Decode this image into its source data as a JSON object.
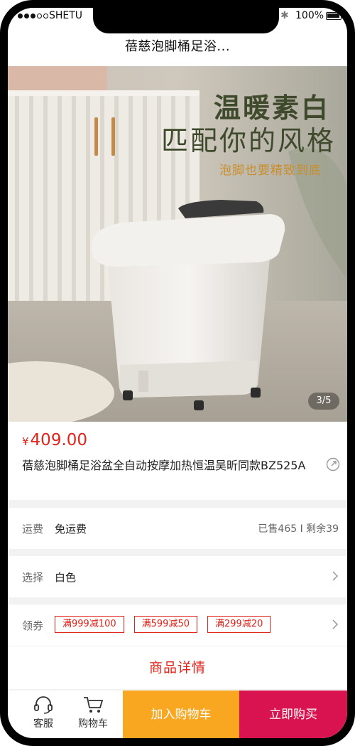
{
  "status": {
    "carrier": "SHETU",
    "battery": "100%",
    "bluetooth_glyph": "✱"
  },
  "nav": {
    "title": "蓓慈泡脚桶足浴..."
  },
  "hero": {
    "line1": "温暖素白",
    "line2": "匹配你的风格",
    "line3": "泡脚也要精致到底",
    "pager": "3/5"
  },
  "product": {
    "currency": "¥",
    "price": "409.00",
    "title": "蓓慈泡脚桶足浴盆全自动按摩加热恒温吴昕同款BZ525A"
  },
  "shipping": {
    "label": "运费",
    "value": "免运费",
    "stats": "已售465 I 剩余39"
  },
  "selection": {
    "label": "选择",
    "value": "白色"
  },
  "coupons": {
    "label": "领券",
    "items": [
      "满999减100",
      "满599减50",
      "满299减20"
    ]
  },
  "detail_tab": "商品详情",
  "bottom": {
    "service": "客服",
    "cart": "购物车",
    "add_to_cart": "加入购物车",
    "buy_now": "立即购买"
  },
  "colors": {
    "price_red": "#e2231a",
    "cart_orange": "#f9a620",
    "buy_magenta": "#d9134f",
    "hero_green": "#3f4a2c",
    "hero_gold": "#c98e2b"
  }
}
